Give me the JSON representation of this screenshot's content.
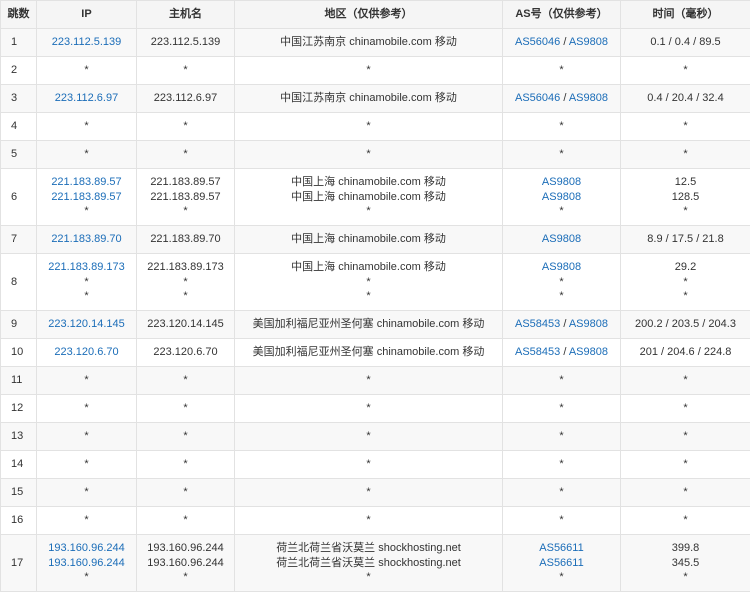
{
  "headers": [
    "跳数",
    "IP",
    "主机名",
    "地区（仅供参考）",
    "AS号（仅供参考）",
    "时间（毫秒）"
  ],
  "colors": {
    "link": "#1b6db8",
    "border": "#e2e2e2",
    "stripe": "#f8f8f8"
  },
  "rows": [
    {
      "hop": "1",
      "ip": [
        "223.112.5.139"
      ],
      "host": [
        "223.112.5.139"
      ],
      "region": [
        "中国江苏南京 chinamobile.com 移动"
      ],
      "as": [
        [
          "AS56046",
          "AS9808"
        ]
      ],
      "time": [
        "0.1 / 0.4 / 89.5"
      ]
    },
    {
      "hop": "2",
      "ip": [
        "*"
      ],
      "host": [
        "*"
      ],
      "region": [
        "*"
      ],
      "as": [
        [
          "*"
        ]
      ],
      "time": [
        "*"
      ]
    },
    {
      "hop": "3",
      "ip": [
        "223.112.6.97"
      ],
      "host": [
        "223.112.6.97"
      ],
      "region": [
        "中国江苏南京 chinamobile.com 移动"
      ],
      "as": [
        [
          "AS56046",
          "AS9808"
        ]
      ],
      "time": [
        "0.4 / 20.4 / 32.4"
      ]
    },
    {
      "hop": "4",
      "ip": [
        "*"
      ],
      "host": [
        "*"
      ],
      "region": [
        "*"
      ],
      "as": [
        [
          "*"
        ]
      ],
      "time": [
        "*"
      ]
    },
    {
      "hop": "5",
      "ip": [
        "*"
      ],
      "host": [
        "*"
      ],
      "region": [
        "*"
      ],
      "as": [
        [
          "*"
        ]
      ],
      "time": [
        "*"
      ]
    },
    {
      "hop": "6",
      "ip": [
        "221.183.89.57",
        "221.183.89.57",
        "*"
      ],
      "host": [
        "221.183.89.57",
        "221.183.89.57",
        "*"
      ],
      "region": [
        "中国上海 chinamobile.com 移动",
        "中国上海 chinamobile.com 移动",
        "*"
      ],
      "as": [
        [
          "AS9808"
        ],
        [
          "AS9808"
        ],
        [
          "*"
        ]
      ],
      "time": [
        "12.5",
        "128.5",
        "*"
      ]
    },
    {
      "hop": "7",
      "ip": [
        "221.183.89.70"
      ],
      "host": [
        "221.183.89.70"
      ],
      "region": [
        "中国上海 chinamobile.com 移动"
      ],
      "as": [
        [
          "AS9808"
        ]
      ],
      "time": [
        "8.9 / 17.5 / 21.8"
      ]
    },
    {
      "hop": "8",
      "ip": [
        "221.183.89.173",
        "*",
        "*"
      ],
      "host": [
        "221.183.89.173",
        "*",
        "*"
      ],
      "region": [
        "中国上海 chinamobile.com 移动",
        "*",
        "*"
      ],
      "as": [
        [
          "AS9808"
        ],
        [
          "*"
        ],
        [
          "*"
        ]
      ],
      "time": [
        "29.2",
        "*",
        "*"
      ]
    },
    {
      "hop": "9",
      "ip": [
        "223.120.14.145"
      ],
      "host": [
        "223.120.14.145"
      ],
      "region": [
        "美国加利福尼亚州圣何塞 chinamobile.com 移动"
      ],
      "as": [
        [
          "AS58453",
          "AS9808"
        ]
      ],
      "time": [
        "200.2 / 203.5 / 204.3"
      ]
    },
    {
      "hop": "10",
      "ip": [
        "223.120.6.70"
      ],
      "host": [
        "223.120.6.70"
      ],
      "region": [
        "美国加利福尼亚州圣何塞 chinamobile.com 移动"
      ],
      "as": [
        [
          "AS58453",
          "AS9808"
        ]
      ],
      "time": [
        "201 / 204.6 / 224.8"
      ]
    },
    {
      "hop": "11",
      "ip": [
        "*"
      ],
      "host": [
        "*"
      ],
      "region": [
        "*"
      ],
      "as": [
        [
          "*"
        ]
      ],
      "time": [
        "*"
      ]
    },
    {
      "hop": "12",
      "ip": [
        "*"
      ],
      "host": [
        "*"
      ],
      "region": [
        "*"
      ],
      "as": [
        [
          "*"
        ]
      ],
      "time": [
        "*"
      ]
    },
    {
      "hop": "13",
      "ip": [
        "*"
      ],
      "host": [
        "*"
      ],
      "region": [
        "*"
      ],
      "as": [
        [
          "*"
        ]
      ],
      "time": [
        "*"
      ]
    },
    {
      "hop": "14",
      "ip": [
        "*"
      ],
      "host": [
        "*"
      ],
      "region": [
        "*"
      ],
      "as": [
        [
          "*"
        ]
      ],
      "time": [
        "*"
      ]
    },
    {
      "hop": "15",
      "ip": [
        "*"
      ],
      "host": [
        "*"
      ],
      "region": [
        "*"
      ],
      "as": [
        [
          "*"
        ]
      ],
      "time": [
        "*"
      ]
    },
    {
      "hop": "16",
      "ip": [
        "*"
      ],
      "host": [
        "*"
      ],
      "region": [
        "*"
      ],
      "as": [
        [
          "*"
        ]
      ],
      "time": [
        "*"
      ]
    },
    {
      "hop": "17",
      "ip": [
        "193.160.96.244",
        "193.160.96.244",
        "*"
      ],
      "host": [
        "193.160.96.244",
        "193.160.96.244",
        "*"
      ],
      "region": [
        "荷兰北荷兰省沃莫兰 shockhosting.net",
        "荷兰北荷兰省沃莫兰 shockhosting.net",
        "*"
      ],
      "as": [
        [
          "AS56611"
        ],
        [
          "AS56611"
        ],
        [
          "*"
        ]
      ],
      "time": [
        "399.8",
        "345.5",
        "*"
      ]
    }
  ]
}
